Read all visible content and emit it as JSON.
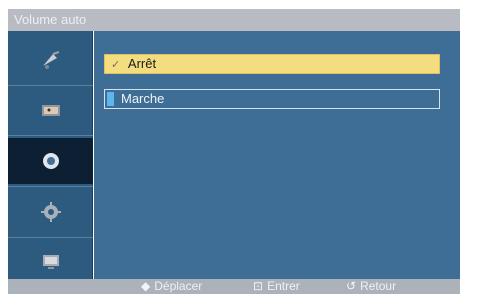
{
  "title": "Volume auto",
  "sidebar": {
    "items": [
      {
        "icon": "satellite-dish-icon",
        "active": false
      },
      {
        "icon": "picture-frame-icon",
        "active": false
      },
      {
        "icon": "speaker-circle-icon",
        "active": true
      },
      {
        "icon": "gear-icon",
        "active": false
      },
      {
        "icon": "monitor-icon",
        "active": false
      }
    ]
  },
  "options": [
    {
      "label": "Arrêt",
      "check": "✓",
      "selected": true
    },
    {
      "label": "Marche",
      "selected": false
    }
  ],
  "footer": {
    "move": {
      "icon": "◆",
      "label": "Déplacer"
    },
    "enter": {
      "icon": "⊡",
      "label": "Entrer"
    },
    "back": {
      "icon": "↺",
      "label": "Retour"
    }
  },
  "colors": {
    "highlight": "#f4dd7e",
    "panel": "#3e6e95",
    "sidebar": "#2d5a7f",
    "active_item": "#0d1f33"
  }
}
